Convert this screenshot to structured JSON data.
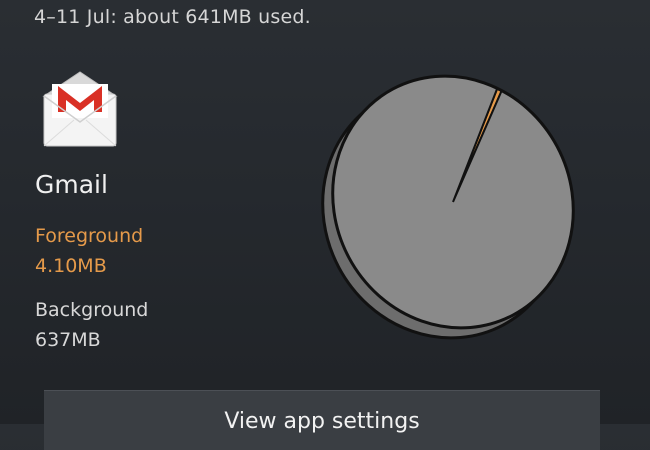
{
  "summary": {
    "text": "4–11 Jul: about 641MB used."
  },
  "app": {
    "name": "Gmail",
    "icon": "gmail-envelope-icon",
    "foreground_label": "Foreground",
    "foreground_value": "4.10MB",
    "background_label": "Background",
    "background_value": "637MB"
  },
  "chart_data": {
    "type": "pie",
    "categories": [
      "Foreground",
      "Background"
    ],
    "values": [
      4.1,
      637
    ],
    "units": "MB",
    "colors": {
      "foreground": "#e59a4a",
      "background": "#8a8a8a"
    }
  },
  "actions": {
    "settings_label": "View app settings"
  },
  "colors": {
    "accent": "#e59a4a",
    "background": "#25292e",
    "button": "#3a3e43"
  }
}
